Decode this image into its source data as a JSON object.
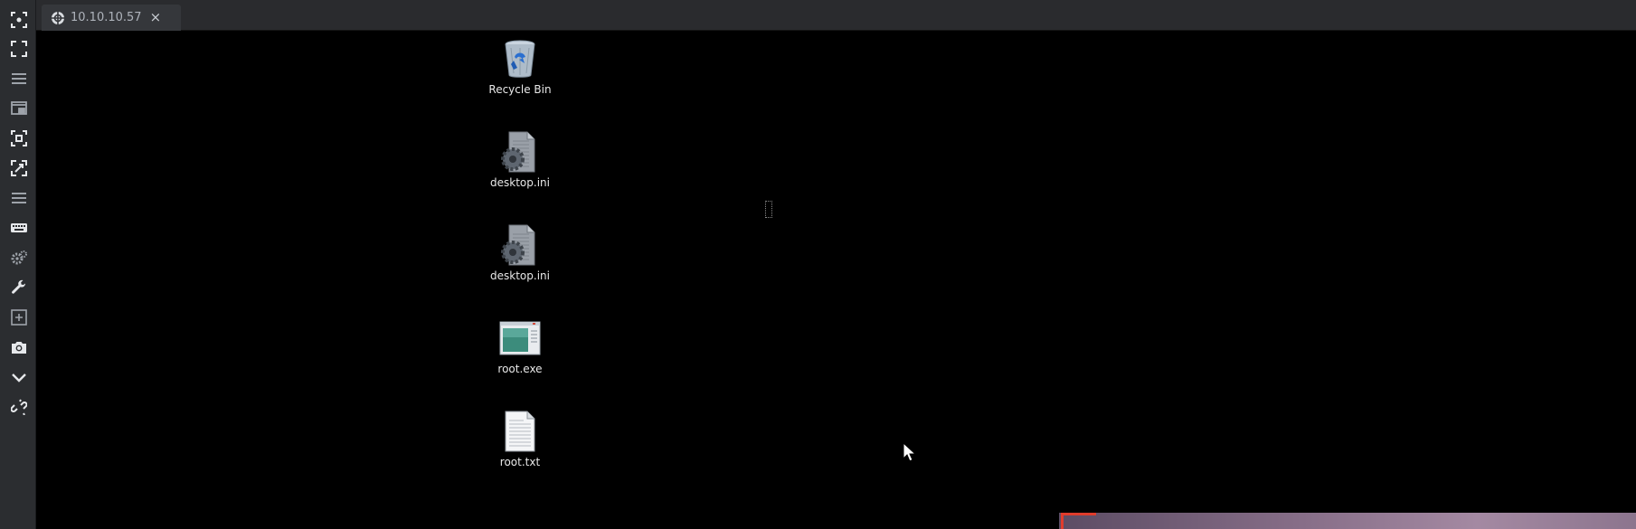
{
  "tab": {
    "label": "10.10.10.57",
    "close_glyph": "×",
    "icon": "target-icon"
  },
  "toolbar": {
    "items": [
      {
        "name": "focus-icon"
      },
      {
        "name": "fullscreen-icon"
      },
      {
        "name": "menu-icon"
      },
      {
        "name": "picture-in-picture-icon"
      },
      {
        "name": "fit-screen-icon"
      },
      {
        "name": "scale-icon"
      },
      {
        "name": "list-icon"
      },
      {
        "name": "keyboard-icon"
      },
      {
        "name": "settings-icon"
      },
      {
        "name": "wrench-icon"
      },
      {
        "name": "add-window-icon"
      },
      {
        "name": "camera-icon"
      },
      {
        "name": "chevron-down-icon"
      },
      {
        "name": "disconnect-icon"
      }
    ]
  },
  "desktop": {
    "icons": [
      {
        "label": "Recycle Bin",
        "icon": "recycle-bin-icon"
      },
      {
        "label": "desktop.ini",
        "icon": "settings-file-icon"
      },
      {
        "label": "desktop.ini",
        "icon": "settings-file-icon"
      },
      {
        "label": "root.exe",
        "icon": "application-icon"
      },
      {
        "label": "root.txt",
        "icon": "text-file-icon"
      }
    ]
  },
  "colors": {
    "toolbar_bg": "#2b2d30",
    "tabbar_bg": "#2a2b2e",
    "tab_bg": "#35373b",
    "desktop_bg": "#000000",
    "icon_label": "#e8e8e8",
    "accent_red": "#e03c2c"
  }
}
